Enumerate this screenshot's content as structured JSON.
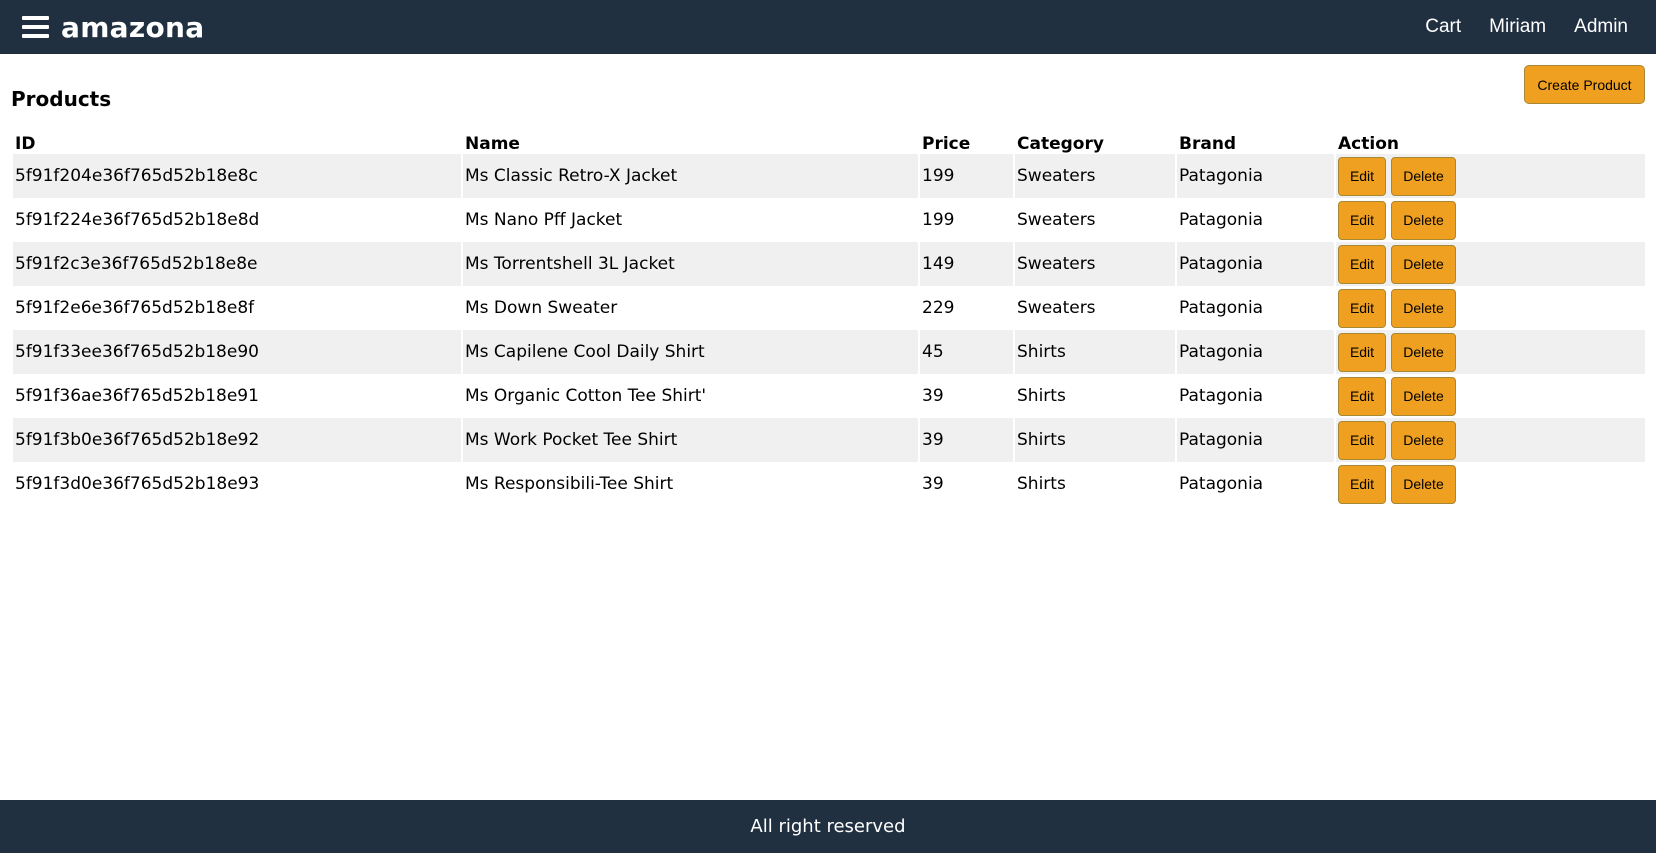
{
  "header": {
    "brand": "amazona",
    "nav": {
      "cart": "Cart",
      "user": "Miriam",
      "admin": "Admin"
    }
  },
  "main": {
    "title": "Products",
    "create_button": "Create Product",
    "table": {
      "columns": [
        "ID",
        "Name",
        "Price",
        "Category",
        "Brand",
        "Action"
      ],
      "rows": [
        {
          "id": "5f91f204e36f765d52b18e8c",
          "name": "Ms Classic Retro-X Jacket",
          "price": "199",
          "category": "Sweaters",
          "brand": "Patagonia"
        },
        {
          "id": "5f91f224e36f765d52b18e8d",
          "name": "Ms Nano Pff Jacket",
          "price": "199",
          "category": "Sweaters",
          "brand": "Patagonia"
        },
        {
          "id": "5f91f2c3e36f765d52b18e8e",
          "name": "Ms Torrentshell 3L Jacket",
          "price": "149",
          "category": "Sweaters",
          "brand": "Patagonia"
        },
        {
          "id": "5f91f2e6e36f765d52b18e8f",
          "name": "Ms Down Sweater",
          "price": "229",
          "category": "Sweaters",
          "brand": "Patagonia"
        },
        {
          "id": "5f91f33ee36f765d52b18e90",
          "name": "Ms Capilene Cool Daily Shirt",
          "price": "45",
          "category": "Shirts",
          "brand": "Patagonia"
        },
        {
          "id": "5f91f36ae36f765d52b18e91",
          "name": "Ms Organic Cotton Tee Shirt'",
          "price": "39",
          "category": "Shirts",
          "brand": "Patagonia"
        },
        {
          "id": "5f91f3b0e36f765d52b18e92",
          "name": "Ms Work Pocket Tee Shirt",
          "price": "39",
          "category": "Shirts",
          "brand": "Patagonia"
        },
        {
          "id": "5f91f3d0e36f765d52b18e93",
          "name": "Ms Responsibili-Tee Shirt",
          "price": "39",
          "category": "Shirts",
          "brand": "Patagonia"
        }
      ],
      "edit_label": "Edit",
      "delete_label": "Delete"
    }
  },
  "footer": {
    "text": "All right reserved"
  },
  "colors": {
    "header_bg": "#203040",
    "button_bg": "#f0a020",
    "row_stripe": "#f0f0f0"
  },
  "icons": {
    "menu": "hamburger-menu-icon"
  }
}
